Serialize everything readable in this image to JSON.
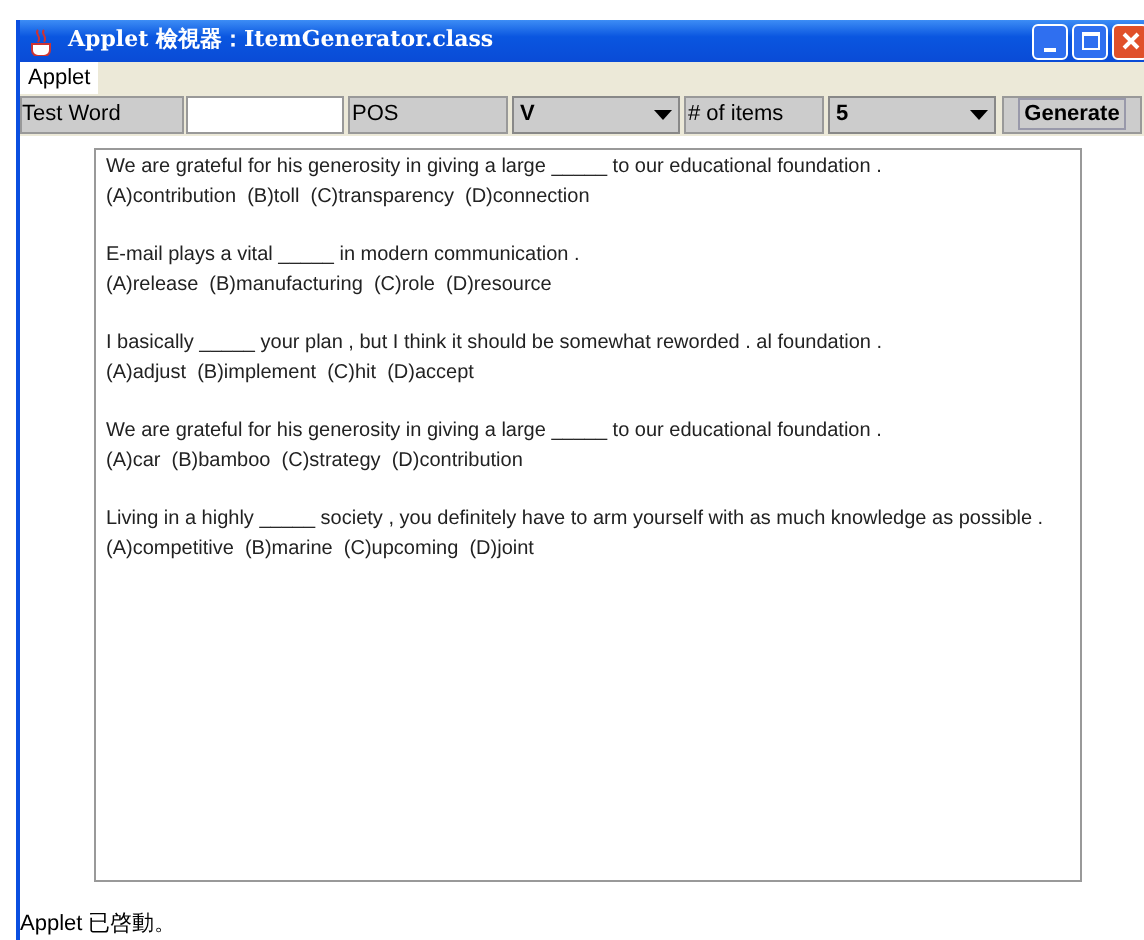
{
  "window": {
    "title": "Applet 檢視器：ItemGenerator.class"
  },
  "menu": [
    "Applet"
  ],
  "toolbar": {
    "test_word_label": "Test Word",
    "pos_label": "POS",
    "pos_value": "V",
    "items_label": "# of items",
    "items_value": "5",
    "generate_button": "Generate"
  },
  "questions": [
    {
      "stem": "We are grateful for his generosity in giving a large _____ to our educational foundation .",
      "options": "(A)contribution  (B)toll  (C)transparency  (D)connection"
    },
    {
      "stem": "E-mail plays a vital _____ in modern communication .",
      "options": "(A)release  (B)manufacturing  (C)role  (D)resource"
    },
    {
      "stem": "I basically _____ your plan , but I think it should be somewhat reworded . al foundation .",
      "options": "(A)adjust  (B)implement  (C)hit  (D)accept"
    },
    {
      "stem": "We are grateful for his generosity in giving a large _____ to our educational foundation .",
      "options": "(A)car  (B)bamboo  (C)strategy  (D)contribution"
    },
    {
      "stem": "Living in a highly _____ society , you definitely have to arm yourself with as much knowledge as possible .",
      "options": "(A)competitive  (B)marine  (C)upcoming  (D)joint"
    }
  ],
  "status_bar": "Applet 已啓動。"
}
